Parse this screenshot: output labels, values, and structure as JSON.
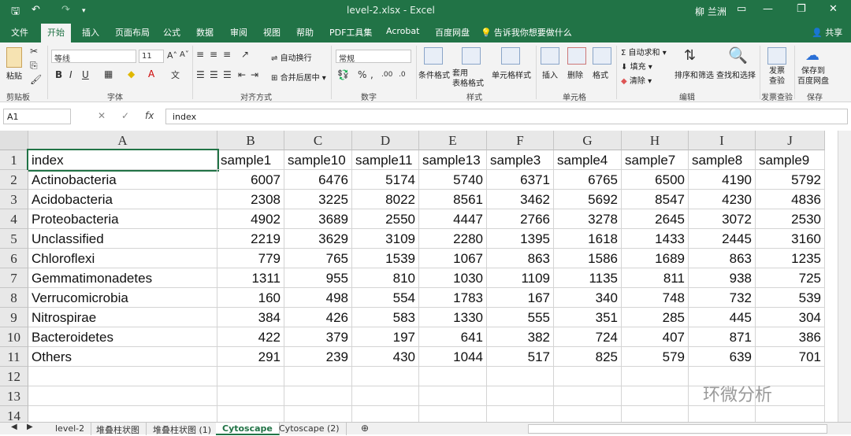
{
  "window": {
    "title": "level-2.xlsx  -  Excel",
    "user": "柳 兰洲"
  },
  "tabs": [
    "文件",
    "开始",
    "插入",
    "页面布局",
    "公式",
    "数据",
    "审阅",
    "视图",
    "帮助",
    "PDF工具集",
    "Acrobat",
    "百度网盘"
  ],
  "tell_me": "告诉我你想要做什么",
  "share": "共享",
  "ribbon": {
    "clipboard": {
      "paste": "粘贴",
      "label": "剪贴板"
    },
    "font": {
      "name": "等线",
      "size": "11",
      "label": "字体"
    },
    "alignment": {
      "wrap": "自动换行",
      "merge": "合并后居中",
      "label": "对齐方式"
    },
    "number": {
      "format": "常规",
      "percent": "%",
      "label": "数字"
    },
    "styles": {
      "conditional": "条件格式",
      "table": "套用\n表格格式",
      "cell": "单元格样式",
      "label": "样式"
    },
    "cells": {
      "insert": "插入",
      "delete": "删除",
      "format": "格式",
      "label": "单元格"
    },
    "editing": {
      "autosum": "自动求和",
      "fill": "填充",
      "clear": "清除",
      "sort": "排序和筛选",
      "find": "查找和选择",
      "label": "编辑"
    },
    "invoice": {
      "check": "发票\n查验",
      "label": "发票查验"
    },
    "save": {
      "save_to": "保存到\n百度网盘",
      "label": "保存"
    }
  },
  "formula_bar": {
    "name_box": "A1",
    "formula": "index"
  },
  "columns": [
    "A",
    "B",
    "C",
    "D",
    "E",
    "F",
    "G",
    "H",
    "I",
    "J"
  ],
  "rows": [
    [
      "index",
      "sample1",
      "sample10",
      "sample11",
      "sample13",
      "sample3",
      "sample4",
      "sample7",
      "sample8",
      "sample9"
    ],
    [
      "Actinobacteria",
      "6007",
      "6476",
      "5174",
      "5740",
      "6371",
      "6765",
      "6500",
      "4190",
      "5792"
    ],
    [
      "Acidobacteria",
      "2308",
      "3225",
      "8022",
      "8561",
      "3462",
      "5692",
      "8547",
      "4230",
      "4836"
    ],
    [
      "Proteobacteria",
      "4902",
      "3689",
      "2550",
      "4447",
      "2766",
      "3278",
      "2645",
      "3072",
      "2530"
    ],
    [
      "Unclassified",
      "2219",
      "3629",
      "3109",
      "2280",
      "1395",
      "1618",
      "1433",
      "2445",
      "3160"
    ],
    [
      "Chloroflexi",
      "779",
      "765",
      "1539",
      "1067",
      "863",
      "1586",
      "1689",
      "863",
      "1235"
    ],
    [
      "Gemmatimonadetes",
      "1311",
      "955",
      "810",
      "1030",
      "1109",
      "1135",
      "811",
      "938",
      "725"
    ],
    [
      "Verrucomicrobia",
      "160",
      "498",
      "554",
      "1783",
      "167",
      "340",
      "748",
      "732",
      "539"
    ],
    [
      "Nitrospirae",
      "384",
      "426",
      "583",
      "1330",
      "555",
      "351",
      "285",
      "445",
      "304"
    ],
    [
      "Bacteroidetes",
      "422",
      "379",
      "197",
      "641",
      "382",
      "724",
      "407",
      "871",
      "386"
    ],
    [
      "Others",
      "291",
      "239",
      "430",
      "1044",
      "517",
      "825",
      "579",
      "639",
      "701"
    ],
    [
      "",
      "",
      "",
      "",
      "",
      "",
      "",
      "",
      "",
      ""
    ],
    [
      "",
      "",
      "",
      "",
      "",
      "",
      "",
      "",
      "",
      ""
    ],
    [
      "",
      "",
      "",
      "",
      "",
      "",
      "",
      "",
      "",
      ""
    ]
  ],
  "sheets": [
    "level-2",
    "堆叠柱状图",
    "堆叠柱状图 (1)",
    "Cytoscape",
    "Cytoscape (2)"
  ],
  "active_sheet": "Cytoscape",
  "watermark": "环微分析",
  "colors": {
    "excel_green": "#217346"
  }
}
